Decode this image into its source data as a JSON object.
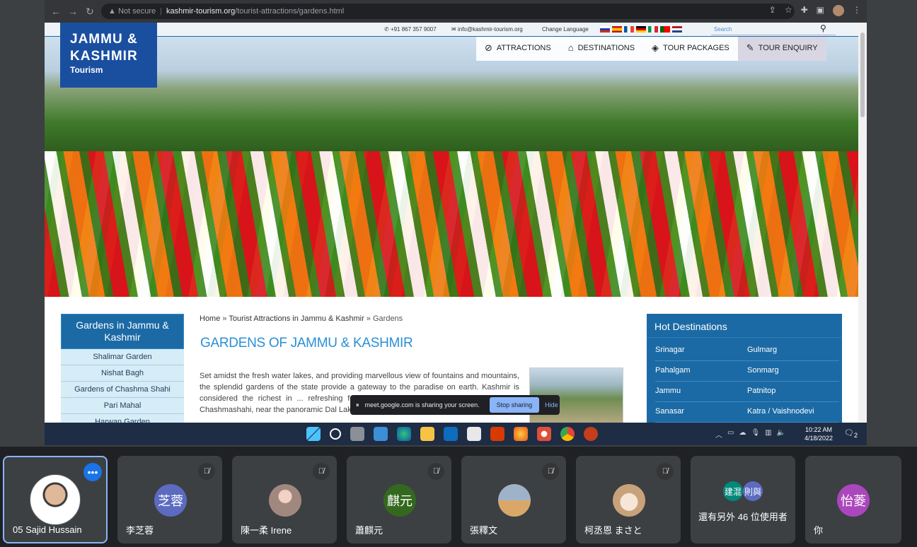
{
  "browser": {
    "back": "←",
    "forward": "→",
    "reload": "↻",
    "security": "▲ Not secure",
    "url_host": "kashmir-tourism.org",
    "url_path": "/tourist-attractions/gardens.html"
  },
  "site": {
    "phone": "+91 867 357 9007",
    "email": "info@kashmir-tourism.org",
    "change_language": "Change Language",
    "search_placeholder": "Search",
    "logo": {
      "line1": "JAMMU &",
      "line2": "KASHMIR",
      "line3": "Tourism"
    },
    "nav": [
      {
        "label": "ATTRACTIONS",
        "icon": "compass-icon"
      },
      {
        "label": "DESTINATIONS",
        "icon": "buildings-icon"
      },
      {
        "label": "TOUR PACKAGES",
        "icon": "tag-icon"
      },
      {
        "label": "TOUR ENQUIRY",
        "icon": "edit-icon"
      }
    ],
    "sidebar": {
      "title": "Gardens in Jammu & Kashmir",
      "items": [
        "Shalimar Garden",
        "Nishat Bagh",
        "Gardens of Chashma Shahi",
        "Pari Mahal",
        "Harwan Garden"
      ]
    },
    "breadcrumb": [
      "Home",
      "Tourist Attractions in Jammu & Kashmir",
      "Gardens"
    ],
    "page_title": "GARDENS OF JAMMU & KASHMIR",
    "body_text": "Set amidst the fresh water lakes, and providing marvellous view of fountains and mountains, the splendid gardens of the state provide a gateway to the paradise on earth. Kashmir is considered the richest in ... refreshing fountains and countless bloom... Nishat Bagh, Chashmashahi, near the panoramic Dal Lake and enchanting hills bears",
    "hot_destinations": {
      "title": "Hot Destinations",
      "items": [
        "Srinagar",
        "Gulmarg",
        "Pahalgam",
        "Sonmarg",
        "Jammu",
        "Patnitop",
        "Sanasar",
        "Katra / Vaishnodevi"
      ]
    }
  },
  "share_bar": {
    "message": "meet.google.com is sharing your screen.",
    "stop": "Stop sharing",
    "hide": "Hide"
  },
  "taskbar": {
    "time": "10:22 AM",
    "date": "4/18/2022",
    "notifications": "2"
  },
  "participants": [
    {
      "name": "05 Sajid Hussain",
      "initials": "",
      "color": ""
    },
    {
      "name": "李芝蓉",
      "initials": "芝蓉",
      "color": "#5c6bc0"
    },
    {
      "name": "陳一柔 Irene",
      "initials": "",
      "color": "#a1887f"
    },
    {
      "name": "蕭麒元",
      "initials": "麒元",
      "color": "#33691e"
    },
    {
      "name": "張釋文",
      "initials": "",
      "color": "#8d99a6"
    },
    {
      "name": "柯丞恩 まさと",
      "initials": "",
      "color": "#c8a27a"
    }
  ],
  "others": {
    "label": "還有另外 46 位使用者",
    "mini1": "建混",
    "mini2": "則與"
  },
  "self_tile": {
    "name": "你",
    "initials": "怡菱",
    "color": "#ab47bc"
  },
  "colors": {
    "accent": "#1b6aa5",
    "meet_blue": "#8ab4f8",
    "brand_logo": "#1a4fa0"
  }
}
